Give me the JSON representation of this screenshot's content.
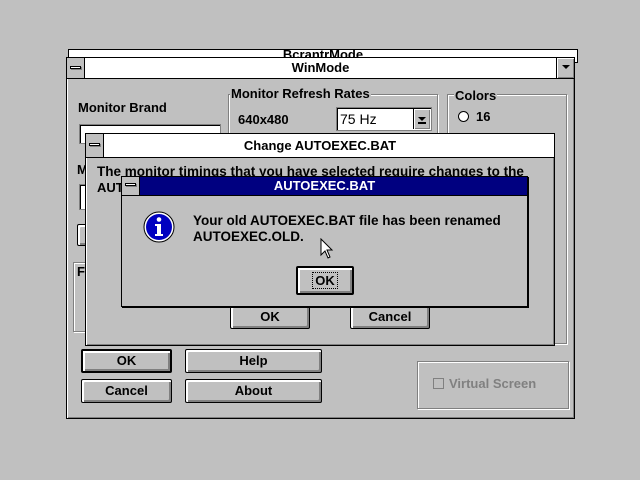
{
  "background_window": {
    "title": "BcrantrMode"
  },
  "winmode": {
    "title": "WinMode",
    "monitor_brand_label": "Monitor Brand",
    "refresh_group_label": "Monitor Refresh Rates",
    "resolution_label": "640x480",
    "refresh_value": "75 Hz",
    "colors_group_label": "Colors",
    "colors_option_16": "16",
    "m_label_fragment": "M",
    "f_label_fragment": "F",
    "buttons": {
      "ok": "OK",
      "help": "Help",
      "cancel": "Cancel",
      "about": "About"
    },
    "virtual_screen_label": "Virtual Screen"
  },
  "change_autoexec": {
    "title": "Change AUTOEXEC.BAT",
    "message_line1": "The monitor timings that you have selected require changes to the",
    "message_line2_fragment": "AUT",
    "ok_label": "OK",
    "cancel_label": "Cancel"
  },
  "msgbox": {
    "title": "AUTOEXEC.BAT",
    "line1": "Your old AUTOEXEC.BAT file has been renamed",
    "line2": "AUTOEXEC.OLD.",
    "ok_label": "OK",
    "icon": "info-icon"
  },
  "colors": {
    "active_title": "#000080",
    "face": "#c0c0c0",
    "shadow": "#808080",
    "highlight": "#ffffff"
  }
}
